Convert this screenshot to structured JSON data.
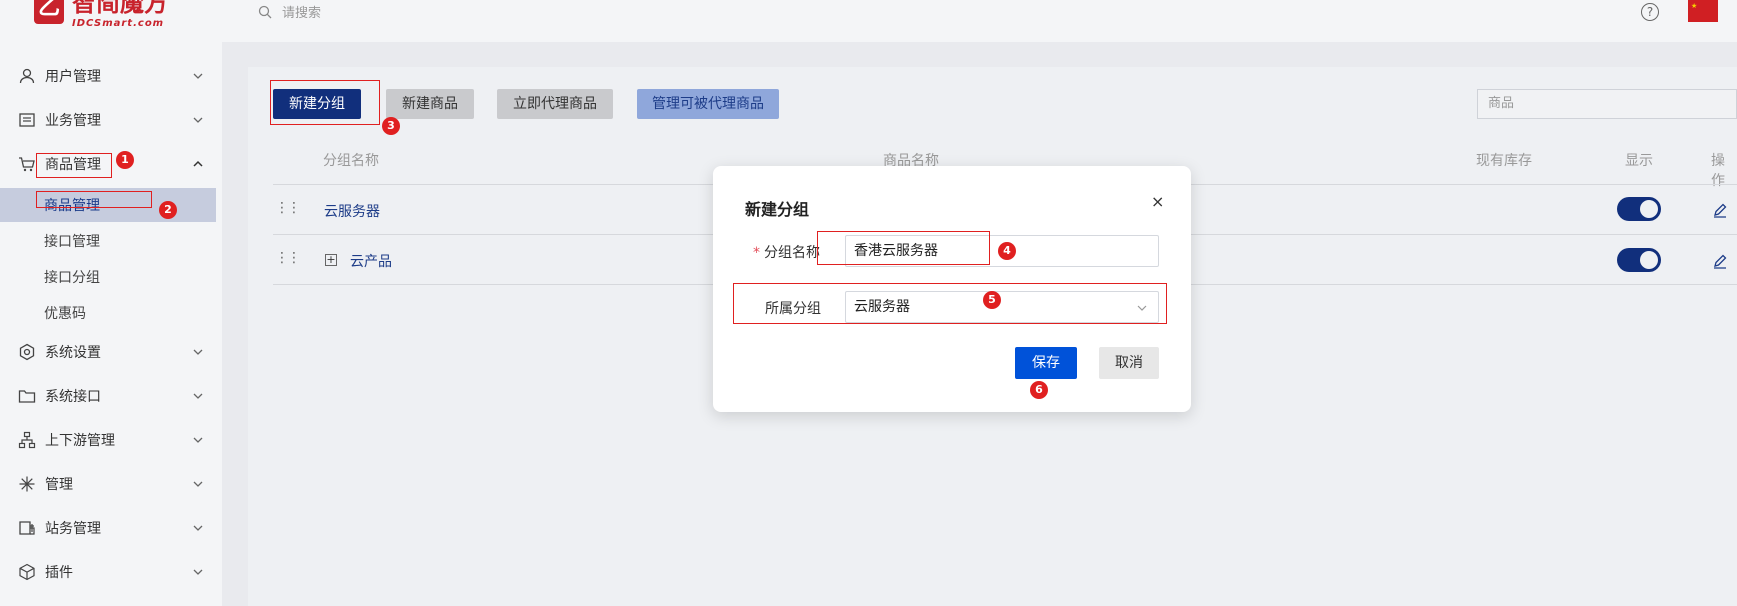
{
  "topbar": {
    "logo_cn": "智简魔方",
    "logo_en": "IDCSmart.com",
    "search_placeholder": "请搜索"
  },
  "sidebar": {
    "items": [
      {
        "label": "用户管理",
        "icon": "user-icon"
      },
      {
        "label": "业务管理",
        "icon": "list-icon"
      },
      {
        "label": "商品管理",
        "icon": "cart-icon"
      },
      {
        "label": "系统设置",
        "icon": "settings-icon"
      },
      {
        "label": "系统接口",
        "icon": "folder-icon"
      },
      {
        "label": "上下游管理",
        "icon": "network-icon"
      },
      {
        "label": "管理",
        "icon": "sparkle-icon"
      },
      {
        "label": "站务管理",
        "icon": "site-icon"
      },
      {
        "label": "插件",
        "icon": "cube-icon"
      }
    ],
    "sub_items": [
      "商品管理",
      "接口管理",
      "接口分组",
      "优惠码"
    ]
  },
  "toolbar": {
    "new_group": "新建分组",
    "new_product": "新建商品",
    "proxy_now": "立即代理商品",
    "manage_proxy": "管理可被代理商品",
    "search_placeholder": "商品"
  },
  "table": {
    "headers": {
      "group_name": "分组名称",
      "product_name": "商品名称",
      "stock": "现有库存",
      "display": "显示",
      "action": "操作"
    },
    "rows": [
      {
        "name": "云服务器",
        "expandable": false,
        "display": true
      },
      {
        "name": "云产品",
        "expandable": true,
        "display": true
      }
    ]
  },
  "dialog": {
    "title": "新建分组",
    "close": "×",
    "name_label": "分组名称",
    "name_value": "香港云服务器",
    "parent_label": "所属分组",
    "parent_value": "云服务器",
    "save": "保存",
    "cancel": "取消"
  },
  "annotations": [
    "1",
    "2",
    "3",
    "4",
    "5",
    "6"
  ],
  "colors": {
    "primary": "#112f7c",
    "save_button": "#0052d9",
    "annotation": "#e02020",
    "brand": "#c8232c"
  }
}
